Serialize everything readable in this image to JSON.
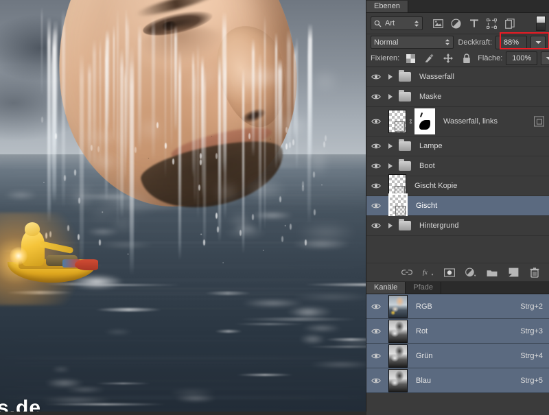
{
  "panel": {
    "tabs": [
      {
        "label": "Ebenen",
        "active": true
      }
    ],
    "filter": {
      "search_icon": "search-icon",
      "kind_label": "Art",
      "icons": [
        {
          "name": "pixel-layer-filter-icon"
        },
        {
          "name": "adjustment-layer-filter-icon"
        },
        {
          "name": "type-layer-filter-icon"
        },
        {
          "name": "shape-layer-filter-icon"
        },
        {
          "name": "smart-object-filter-icon"
        }
      ],
      "toggle_name": "filter-toggle-switch"
    },
    "blend": {
      "mode_label": "Normal",
      "opacity_label": "Deckkraft:",
      "opacity_value": "88%",
      "fill_label": "Fläche:",
      "fill_value": "100%",
      "highlight_color": "#ee1c25"
    },
    "lock": {
      "label": "Fixieren:",
      "icons": [
        {
          "name": "lock-transparency-icon"
        },
        {
          "name": "lock-image-icon"
        },
        {
          "name": "lock-position-icon"
        },
        {
          "name": "lock-all-icon"
        }
      ]
    },
    "layers": [
      {
        "name": "Wasserfall",
        "type": "group",
        "visible": true,
        "selected": false,
        "expanded": false
      },
      {
        "name": "Maske",
        "type": "group",
        "visible": true,
        "selected": false,
        "expanded": false
      },
      {
        "name": "Wasserfall, links",
        "type": "masked-layer",
        "visible": true,
        "selected": false,
        "linked": true,
        "badge": "layer-mask-badge"
      },
      {
        "name": "Lampe",
        "type": "group",
        "visible": true,
        "selected": false,
        "expanded": false
      },
      {
        "name": "Boot",
        "type": "group",
        "visible": true,
        "selected": false,
        "expanded": false
      },
      {
        "name": "Gischt Kopie",
        "type": "pixel",
        "visible": true,
        "selected": false
      },
      {
        "name": "Gischt",
        "type": "pixel",
        "visible": true,
        "selected": true
      },
      {
        "name": "Hintergrund",
        "type": "group",
        "visible": true,
        "selected": false,
        "expanded": false
      }
    ],
    "layer_buttons": [
      {
        "name": "link-layers-button",
        "glyph": "link"
      },
      {
        "name": "layer-style-fx-button",
        "glyph": "fx"
      },
      {
        "name": "add-layer-mask-button",
        "glyph": "mask"
      },
      {
        "name": "new-adjustment-layer-button",
        "glyph": "adjust"
      },
      {
        "name": "new-group-button",
        "glyph": "folder"
      },
      {
        "name": "new-layer-button",
        "glyph": "newlayer"
      },
      {
        "name": "delete-layer-button",
        "glyph": "trash"
      }
    ],
    "channels_panel": {
      "tabs": [
        {
          "label": "Kanäle",
          "active": true
        },
        {
          "label": "Pfade",
          "active": false
        }
      ],
      "channels": [
        {
          "name": "RGB",
          "shortcut": "Strg+2",
          "visible": true,
          "color": true
        },
        {
          "name": "Rot",
          "shortcut": "Strg+3",
          "visible": true,
          "color": false
        },
        {
          "name": "Grün",
          "shortcut": "Strg+4",
          "visible": true,
          "color": false
        },
        {
          "name": "Blau",
          "shortcut": "Strg+5",
          "visible": true,
          "color": false
        }
      ]
    }
  },
  "canvas": {
    "watermark": "s.de",
    "description_name": "photo-composite-canvas"
  }
}
